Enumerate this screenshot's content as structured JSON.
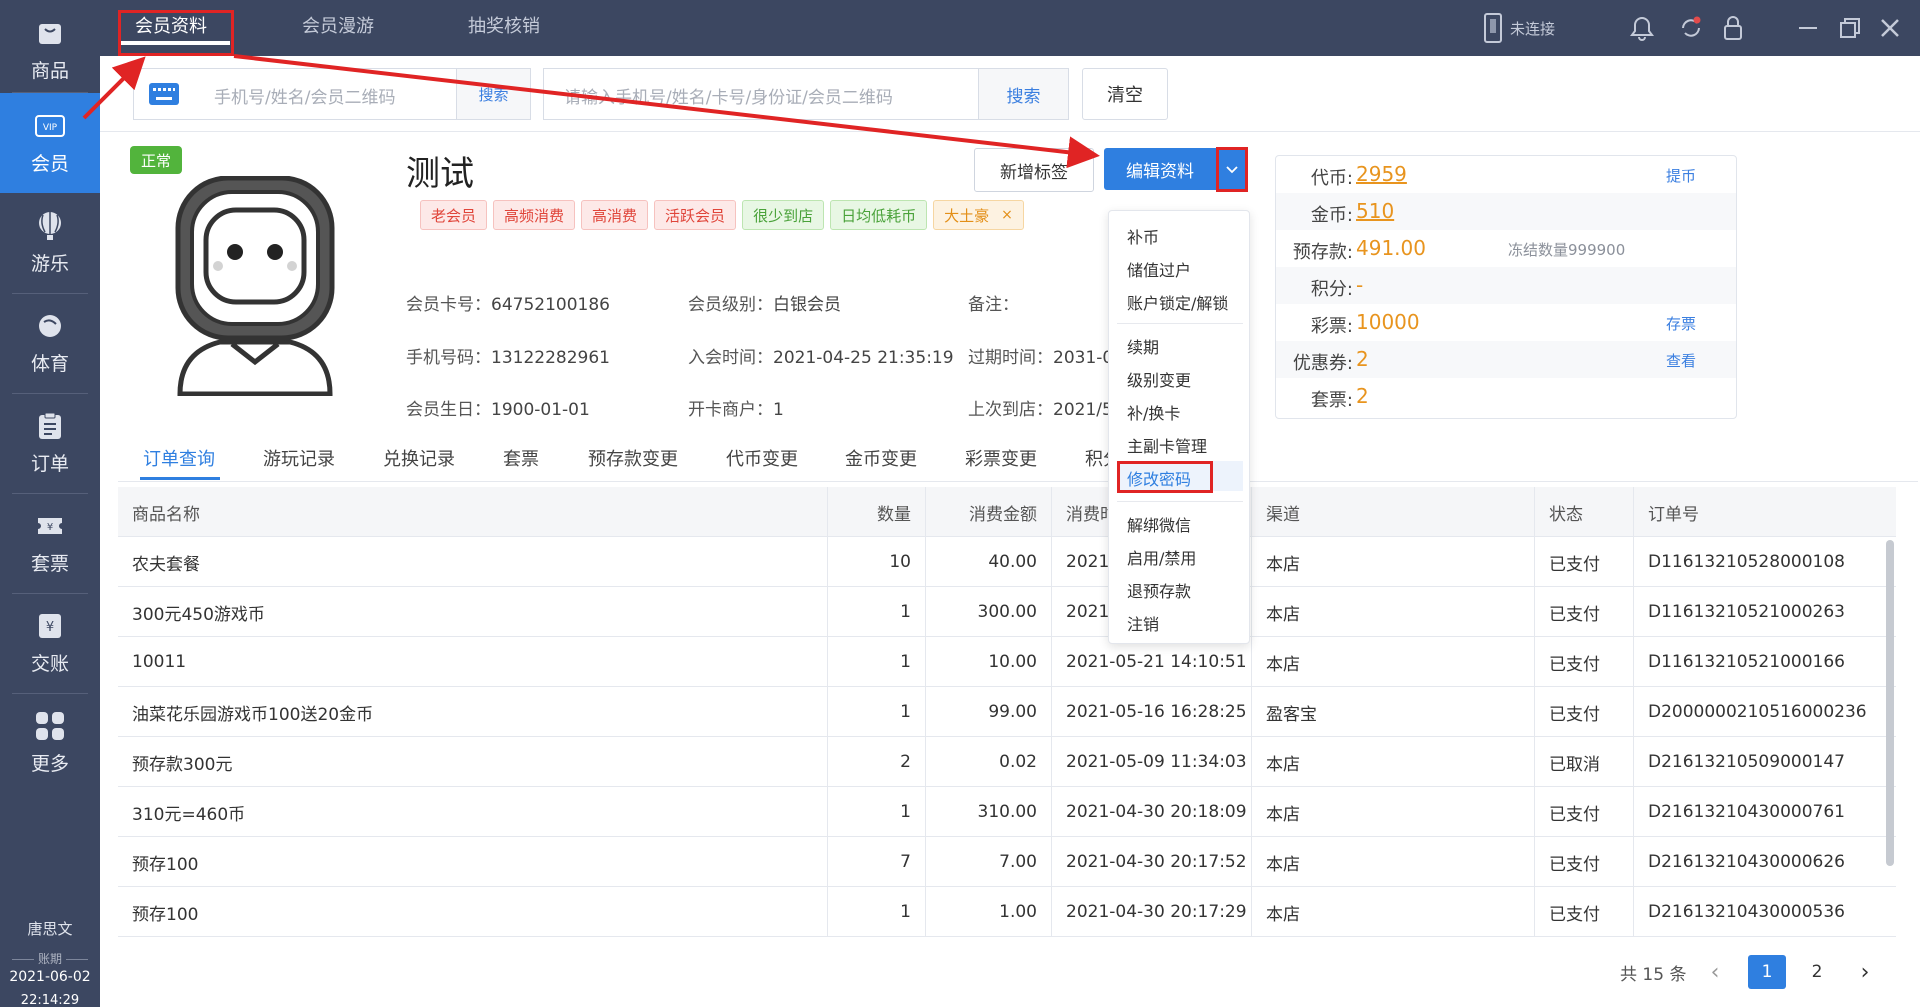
{
  "sidebar": {
    "items": [
      {
        "label": "商品",
        "icon": "goods-icon"
      },
      {
        "label": "会员",
        "icon": "vip-icon"
      },
      {
        "label": "游乐",
        "icon": "balloon-icon"
      },
      {
        "label": "体育",
        "icon": "ball-icon"
      },
      {
        "label": "订单",
        "icon": "clipboard-icon"
      },
      {
        "label": "套票",
        "icon": "ticket-icon"
      },
      {
        "label": "交账",
        "icon": "yen-icon"
      },
      {
        "label": "更多",
        "icon": "grid-icon"
      }
    ],
    "user": "唐思文",
    "period_label": "账期",
    "date": "2021-06-02",
    "time": "22:14:29"
  },
  "topbar": {
    "tabs": [
      "会员资料",
      "会员漫游",
      "抽奖核销"
    ],
    "device_status": "未连接"
  },
  "search": {
    "left_placeholder": "手机号/姓名/会员二维码",
    "left_button": "搜索",
    "main_placeholder": "请输入手机号/姓名/卡号/身份证/会员二维码",
    "main_button": "搜索",
    "clear_button": "清空"
  },
  "member": {
    "status": "正常",
    "name": "测试",
    "tags": [
      {
        "text": "老会员",
        "style": "red"
      },
      {
        "text": "高频消费",
        "style": "red"
      },
      {
        "text": "高消费",
        "style": "red"
      },
      {
        "text": "活跃会员",
        "style": "red"
      },
      {
        "text": "很少到店",
        "style": "green"
      },
      {
        "text": "日均低耗币",
        "style": "green"
      },
      {
        "text": "大土豪",
        "style": "orange"
      }
    ],
    "tag_close": "×",
    "card_no_label": "会员卡号：",
    "card_no": "64752100186",
    "level_label": "会员级别：",
    "level": "白银会员",
    "remark_label": "备注：",
    "phone_label": "手机号码：",
    "phone": "13122282961",
    "join_label": "入会时间：",
    "join_time": "2021-04-25 21:35:19",
    "expire_label": "过期时间：",
    "expire_time": "2031-0",
    "birthday_label": "会员生日：",
    "birthday": "1900-01-01",
    "merchant_label": "开卡商户：",
    "merchant": "1",
    "last_visit_label": "上次到店：",
    "last_visit": "2021/5"
  },
  "actions": {
    "new_tag": "新增标签",
    "edit": "编辑资料"
  },
  "balance": {
    "rows": [
      {
        "label": "代币:",
        "value": "2959",
        "underline": true,
        "link": "提币"
      },
      {
        "label": "金币:",
        "value": "510",
        "underline": true
      },
      {
        "label": "预存款:",
        "value": "491.00",
        "note": "冻结数量999900"
      },
      {
        "label": "积分:",
        "value": "-"
      },
      {
        "label": "彩票:",
        "value": "10000",
        "link": "存票"
      },
      {
        "label": "优惠券:",
        "value": "2",
        "link": "查看"
      },
      {
        "label": "套票:",
        "value": "2"
      }
    ]
  },
  "tabs": [
    "订单查询",
    "游玩记录",
    "兑换记录",
    "套票",
    "预存款变更",
    "代币变更",
    "金币变更",
    "彩票变更",
    "积分"
  ],
  "menu": {
    "items": [
      "补币",
      "储值过户",
      "账户锁定/解锁",
      "续期",
      "级别变更",
      "补/换卡",
      "主副卡管理",
      "修改密码",
      "解绑微信",
      "启用/禁用",
      "退预存款",
      "注销"
    ]
  },
  "table": {
    "headers": [
      "商品名称",
      "数量",
      "消费金额",
      "消费时",
      "渠道",
      "状态",
      "订单号"
    ],
    "rows": [
      [
        "农夫套餐",
        "10",
        "40.00",
        "2021-",
        "本店",
        "已支付",
        "D11613210528000108"
      ],
      [
        "300元450游戏币",
        "1",
        "300.00",
        "2021-",
        "本店",
        "已支付",
        "D11613210521000263"
      ],
      [
        "10011",
        "1",
        "10.00",
        "2021-05-21 14:10:51",
        "本店",
        "已支付",
        "D11613210521000166"
      ],
      [
        "油菜花乐园游戏币100送20金币",
        "1",
        "99.00",
        "2021-05-16 16:28:25",
        "盈客宝",
        "已支付",
        "D2000000210516000236"
      ],
      [
        "预存款300元",
        "2",
        "0.02",
        "2021-05-09 11:34:03",
        "本店",
        "已取消",
        "D21613210509000147"
      ],
      [
        "310元=460币",
        "1",
        "310.00",
        "2021-04-30 20:18:09",
        "本店",
        "已支付",
        "D21613210430000761"
      ],
      [
        "预存100",
        "7",
        "7.00",
        "2021-04-30 20:17:52",
        "本店",
        "已支付",
        "D21613210430000626"
      ],
      [
        "预存100",
        "1",
        "1.00",
        "2021-04-30 20:17:29",
        "本店",
        "已支付",
        "D21613210430000536"
      ]
    ]
  },
  "pagination": {
    "total": "共 15 条",
    "prev": "‹",
    "next": "›",
    "pages": [
      "1",
      "2"
    ]
  },
  "colors": {
    "sidebar_bg": "#3c4761",
    "accent": "#2f7fe0",
    "highlight_red": "#e02424",
    "value_orange": "#e8941e",
    "status_green": "#52b43c"
  }
}
